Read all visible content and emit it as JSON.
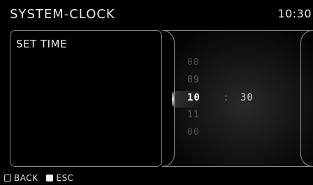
{
  "header": {
    "title": "SYSTEM-CLOCK",
    "clock": "10:30"
  },
  "left_panel": {
    "title": "SET TIME"
  },
  "time_picker": {
    "hours": [
      "08",
      "09",
      "10",
      "11",
      "00"
    ],
    "selected_hour": "10",
    "separator": ":",
    "minute": "30"
  },
  "footer": {
    "back_label": "BACK",
    "back_icon": "hollow-square-icon",
    "esc_label": "ESC",
    "esc_icon": "solid-square-icon"
  }
}
